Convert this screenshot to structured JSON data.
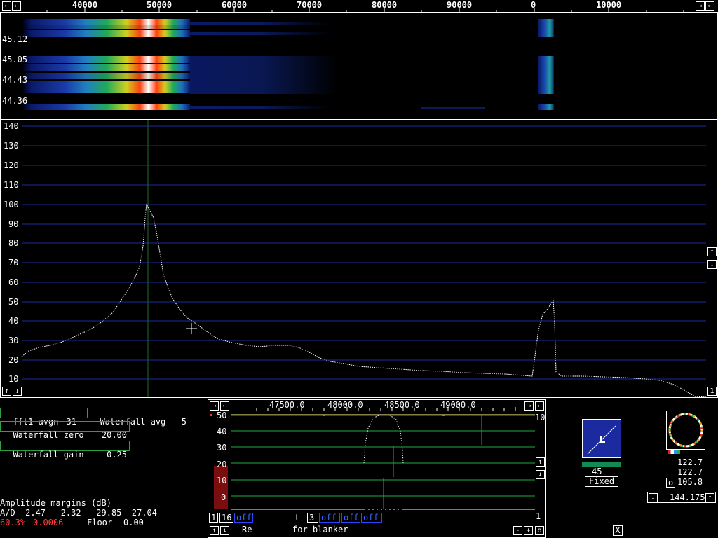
{
  "top_axis": {
    "ticks": [
      "40000",
      "50000",
      "60000",
      "70000",
      "80000",
      "90000",
      "0",
      "10000"
    ]
  },
  "waterfall": {
    "times": [
      "45.12",
      "45.05",
      "44.43",
      "44.36"
    ]
  },
  "spectrum": {
    "y_ticks": [
      "140",
      "130",
      "120",
      "110",
      "100",
      "90",
      "80",
      "70",
      "60",
      "50",
      "40",
      "30",
      "20",
      "10"
    ]
  },
  "panel": {
    "fft1_label": "fft1 avgn",
    "fft1_value": "31",
    "wf_avg_label": "Waterfall avg",
    "wf_avg_value": "5",
    "wf_zero_label": "Waterfall zero",
    "wf_zero_value": "20.00",
    "wf_gain_label": "Waterfall gain",
    "wf_gain_value": "0.25",
    "amp_title": "Amplitude margins (dB)",
    "ad_line": "A/D  2.47   2.32   29.85  27.04",
    "ad_pct": "60.3%",
    "ad_small": "0.0006",
    "floor_label": "Floor",
    "floor_value": "0.00"
  },
  "baseband": {
    "x_ticks": [
      "47500.0",
      "48000.0",
      "48500.0",
      "49000.0"
    ],
    "y_ticks": [
      "50",
      "40",
      "30",
      "20",
      "10",
      "0"
    ],
    "right_top": "10",
    "right_bottom": "1",
    "btn_1": "1",
    "btn_16": "16",
    "off1": "off",
    "t_label": "t",
    "t_value": "3",
    "off2": "off",
    "off3": "off",
    "off4": "off",
    "re_label": "Re",
    "blanker_label": "for blanker",
    "minus": "-",
    "plus": "+",
    "o": "o"
  },
  "smeter": {
    "value": "45",
    "mode": "Fixed"
  },
  "polar": {
    "v1": "122.7",
    "v2": "122.7",
    "o_label": "o",
    "v3": "105.8"
  },
  "freq": {
    "value": "144.175"
  },
  "close_label": "X",
  "buttons": {
    "left": "←",
    "right": "→",
    "up": "↑",
    "down": "↓",
    "one": "1"
  },
  "colors": {
    "grid": "#1a2e9c",
    "green_box": "#2ea043",
    "red_text": "#ff4040"
  }
}
